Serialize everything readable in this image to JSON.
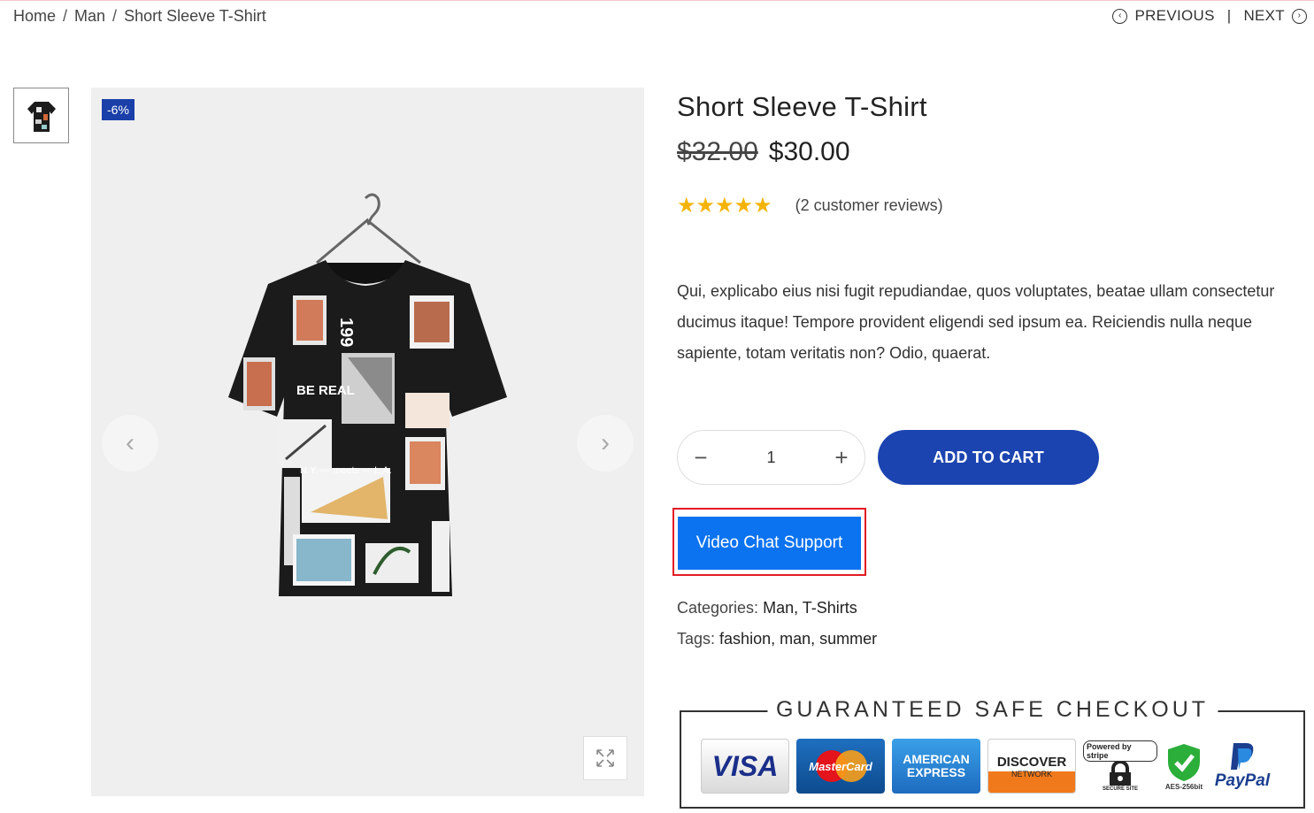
{
  "breadcrumb": {
    "items": [
      "Home",
      "Man",
      "Short Sleeve T-Shirt"
    ],
    "sep": "/"
  },
  "pager": {
    "previous": "PREVIOUS",
    "divider": "|",
    "next": "NEXT"
  },
  "gallery": {
    "badge": "-6%"
  },
  "product": {
    "title": "Short Sleeve T-Shirt",
    "old_price": "$32.00",
    "price": "$30.00",
    "stars": "★★★★★",
    "rating": 5,
    "reviews": "(2 customer reviews)",
    "description": "Qui, explicabo eius nisi fugit repudiandae, quos voluptates, beatae ullam consectetur ducimus itaque! Tempore provident eligendi sed ipsum ea. Reiciendis nulla neque sapiente, totam veritatis non? Odio, quaerat."
  },
  "cart": {
    "quantity": "1",
    "minus": "−",
    "plus": "+",
    "add_label": "ADD TO CART"
  },
  "support": {
    "video_label": "Video Chat Support"
  },
  "meta": {
    "categories_label": "Categories:",
    "categories": "Man, T-Shirts",
    "tags_label": "Tags:",
    "tags": "fashion, man, summer"
  },
  "checkout": {
    "title": "GUARANTEED SAFE CHECKOUT",
    "visa": "VISA",
    "mastercard": "MasterCard",
    "amex": "AMERICAN EXPRESS",
    "discover": "DISCOVER",
    "discover_sub": "NETWORK",
    "stripe": "Powered by stripe",
    "stripe_sub": "SECURE SITE",
    "aes": "AES-256bit",
    "paypal": "PayPal"
  },
  "colors": {
    "accent": "#1c44b0",
    "video": "#0b73f0",
    "highlight": "#e31b23",
    "star": "#f5b301"
  }
}
